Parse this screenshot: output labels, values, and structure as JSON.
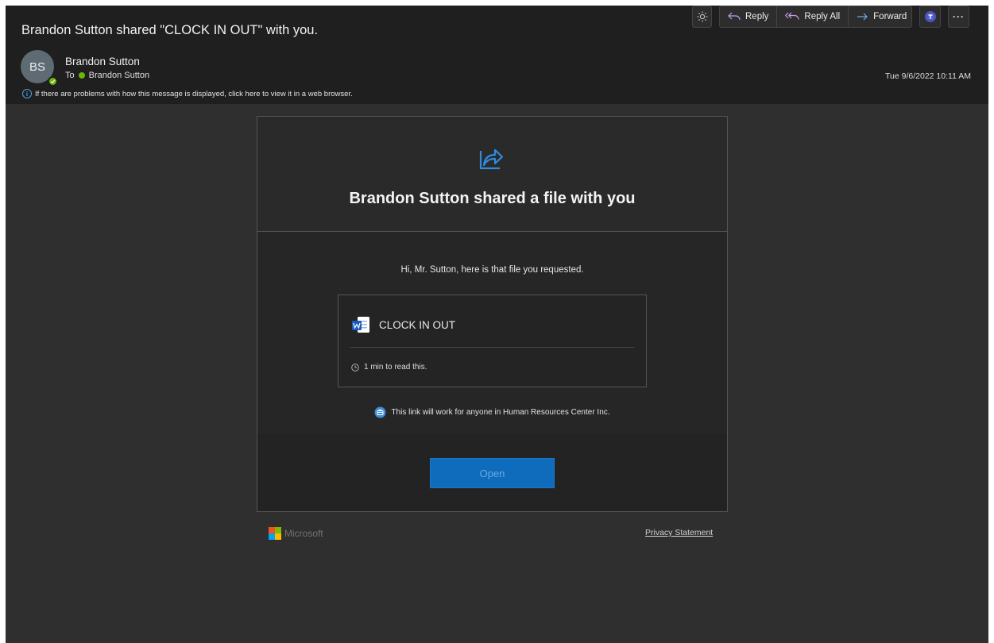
{
  "message": {
    "subject": "Brandon Sutton shared \"CLOCK IN OUT\" with you.",
    "sender_initials": "BS",
    "sender_name": "Brandon Sutton",
    "to_label": "To",
    "to_name": "Brandon Sutton",
    "info_text": "If there are problems with how this message is displayed, click here to view it in a web browser.",
    "timestamp": "Tue 9/6/2022 10:11 AM"
  },
  "toolbar": {
    "reply_label": "Reply",
    "reply_all_label": "Reply All",
    "forward_label": "Forward",
    "more_label": "···"
  },
  "body": {
    "title": "Brandon Sutton shared a file with you",
    "greeting": "Hi, Mr. Sutton, here is that file you requested.",
    "file_name": "CLOCK IN OUT",
    "read_time": "1 min to read this.",
    "link_note": "This link will work for anyone in Human Resources Center Inc.",
    "open_label": "Open"
  },
  "footer": {
    "brand": "Microsoft",
    "privacy_label": "Privacy Statement"
  },
  "colors": {
    "accent_blue": "#0f6cbd",
    "presence_green": "#6bb700",
    "header_bg": "#1f1f1f",
    "body_bg": "#2f2f2f"
  },
  "icons": [
    "brightness-icon",
    "reply-icon",
    "reply-all-icon",
    "forward-icon",
    "teams-icon",
    "share-icon",
    "word-icon",
    "clock-icon",
    "organization-icon",
    "info-icon",
    "microsoft-logo"
  ]
}
